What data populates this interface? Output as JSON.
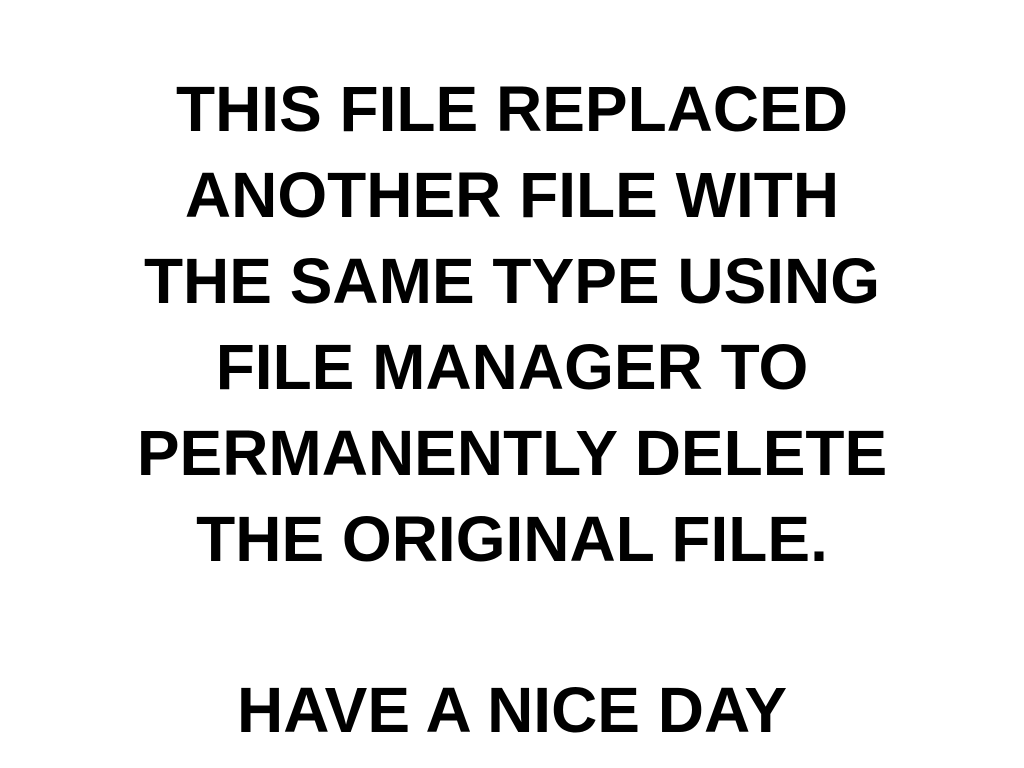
{
  "message": {
    "lines": [
      "THIS FILE REPLACED",
      "ANOTHER FILE WITH",
      "THE SAME TYPE USING",
      "FILE MANAGER TO",
      "PERMANENTLY DELETE",
      "THE ORIGINAL FILE."
    ],
    "signoff": "HAVE A NICE DAY"
  },
  "colors": {
    "background": "#ffffff",
    "text": "#000000"
  }
}
